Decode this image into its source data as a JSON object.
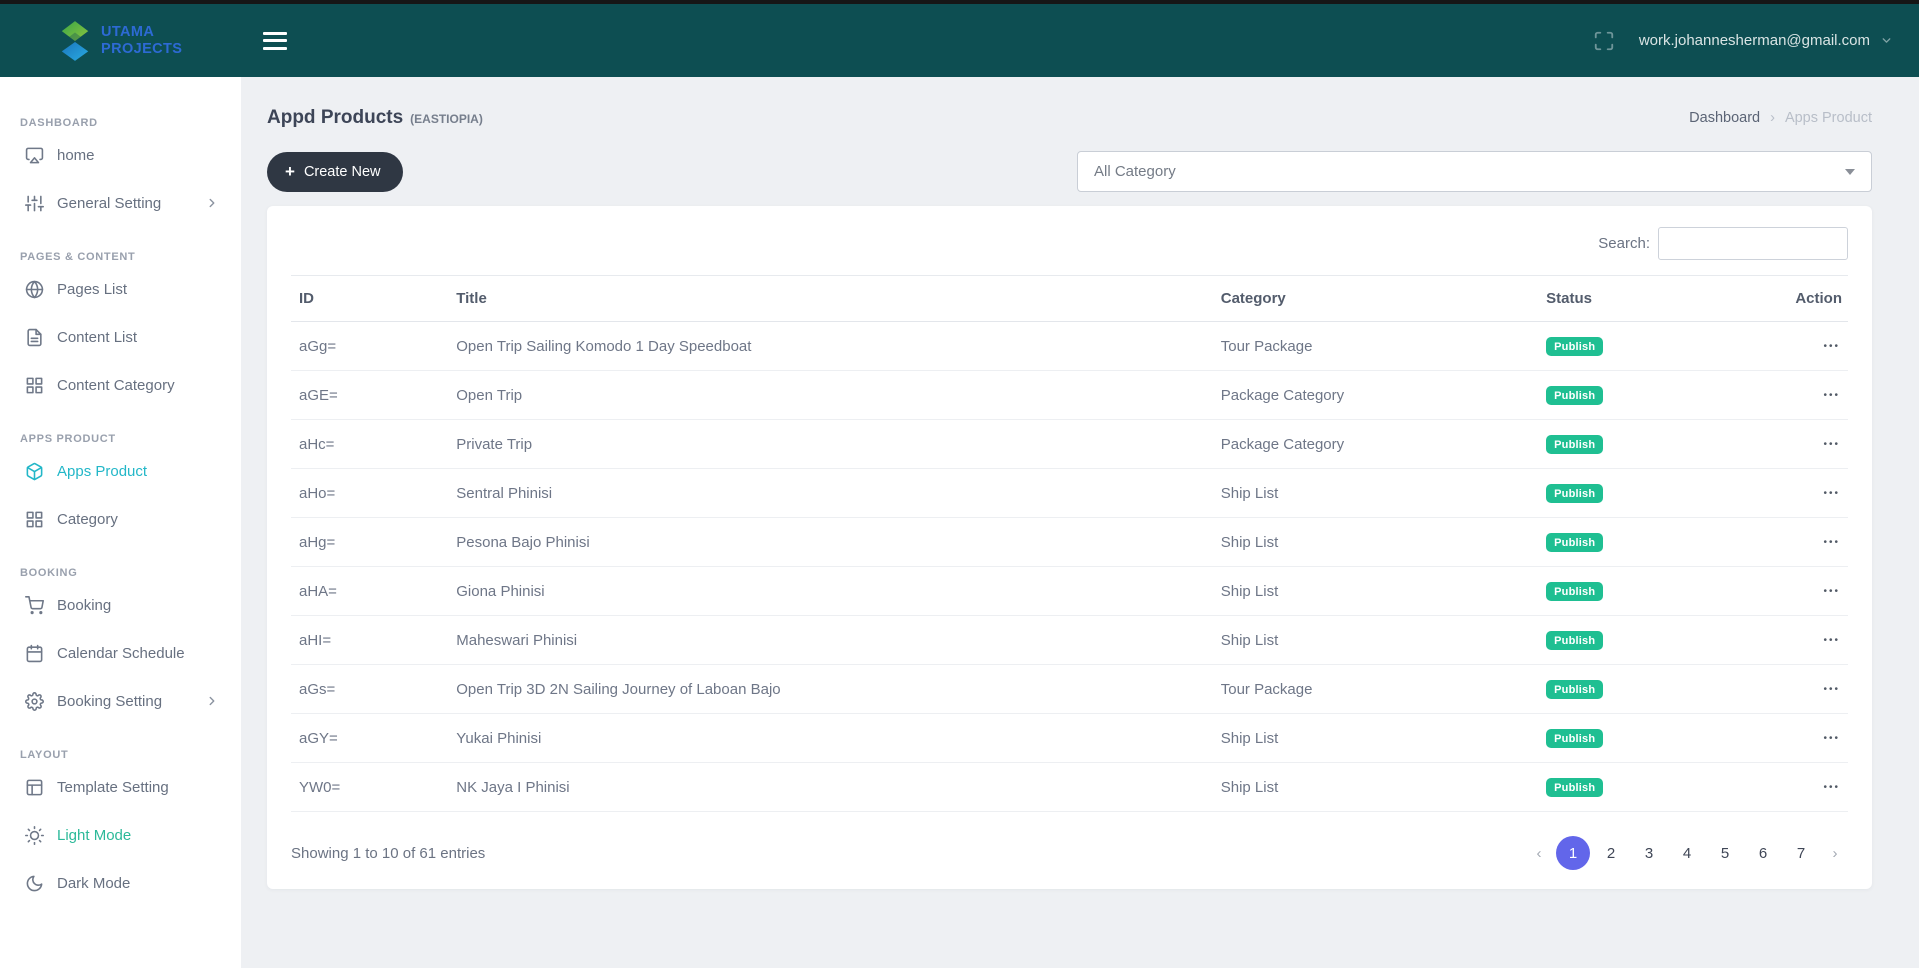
{
  "topbar": {
    "brand_line1": "UTAMA",
    "brand_line2": "PROJECTS",
    "user_email": "work.johannesherman@gmail.com"
  },
  "sidebar": {
    "sections": [
      {
        "header": "DASHBOARD",
        "items": [
          {
            "label": "home",
            "icon": "airplay"
          },
          {
            "label": "General Setting",
            "icon": "sliders",
            "chevron": true
          }
        ]
      },
      {
        "header": "PAGES & CONTENT",
        "items": [
          {
            "label": "Pages List",
            "icon": "globe"
          },
          {
            "label": "Content List",
            "icon": "file-text"
          },
          {
            "label": "Content Category",
            "icon": "grid"
          }
        ]
      },
      {
        "header": "APPS PRODUCT",
        "items": [
          {
            "label": "Apps Product",
            "icon": "package",
            "state": "active-teal"
          },
          {
            "label": "Category",
            "icon": "grid"
          }
        ]
      },
      {
        "header": "BOOKING",
        "items": [
          {
            "label": "Booking",
            "icon": "cart"
          },
          {
            "label": "Calendar Schedule",
            "icon": "calendar"
          },
          {
            "label": "Booking Setting",
            "icon": "gear",
            "chevron": true
          }
        ]
      },
      {
        "header": "LAYOUT",
        "items": [
          {
            "label": "Template Setting",
            "icon": "layout"
          },
          {
            "label": "Light Mode",
            "icon": "sun",
            "state": "active-green"
          },
          {
            "label": "Dark Mode",
            "icon": "moon"
          }
        ]
      }
    ]
  },
  "page": {
    "title": "Appd Products",
    "subtitle": "(EASTIOPIA)",
    "breadcrumb": [
      "Dashboard",
      "Apps Product"
    ],
    "breadcrumb_separator": "›",
    "create_label": "Create New",
    "create_plus": "+",
    "category_filter_value": "All Category",
    "search_label": "Search:",
    "search_value": ""
  },
  "table": {
    "columns": [
      "ID",
      "Title",
      "Category",
      "Status",
      "Action"
    ],
    "rows": [
      {
        "id": "aGg=",
        "title": "Open Trip Sailing Komodo 1 Day Speedboat",
        "category": "Tour Package",
        "status": "Publish"
      },
      {
        "id": "aGE=",
        "title": "Open Trip",
        "category": "Package Category",
        "status": "Publish"
      },
      {
        "id": "aHc=",
        "title": "Private Trip",
        "category": "Package Category",
        "status": "Publish"
      },
      {
        "id": "aHo=",
        "title": "Sentral Phinisi",
        "category": "Ship List",
        "status": "Publish"
      },
      {
        "id": "aHg=",
        "title": "Pesona Bajo Phinisi",
        "category": "Ship List",
        "status": "Publish"
      },
      {
        "id": "aHA=",
        "title": "Giona Phinisi",
        "category": "Ship List",
        "status": "Publish"
      },
      {
        "id": "aHI=",
        "title": "Maheswari Phinisi",
        "category": "Ship List",
        "status": "Publish"
      },
      {
        "id": "aGs=",
        "title": "Open Trip 3D 2N Sailing Journey of Laboan Bajo",
        "category": "Tour Package",
        "status": "Publish"
      },
      {
        "id": "aGY=",
        "title": "Yukai Phinisi",
        "category": "Ship List",
        "status": "Publish"
      },
      {
        "id": "YW0=",
        "title": "NK Jaya I Phinisi",
        "category": "Ship List",
        "status": "Publish"
      }
    ],
    "action_dots": "•••",
    "footer_text": "Showing 1 to 10 of 61 entries",
    "pagination": {
      "prev": "‹",
      "next": "›",
      "pages": [
        "1",
        "2",
        "3",
        "4",
        "5",
        "6",
        "7"
      ],
      "active": "1"
    }
  },
  "colors": {
    "topbar": "#0d4e52",
    "brand_blue": "#2d6ad4",
    "accent_teal": "#23b7c8",
    "accent_green": "#2cb999",
    "badge_green": "#1fbf92",
    "pagination_active": "#6266ea",
    "button_dark": "#2f3743",
    "content_bg": "#eef0f3"
  }
}
